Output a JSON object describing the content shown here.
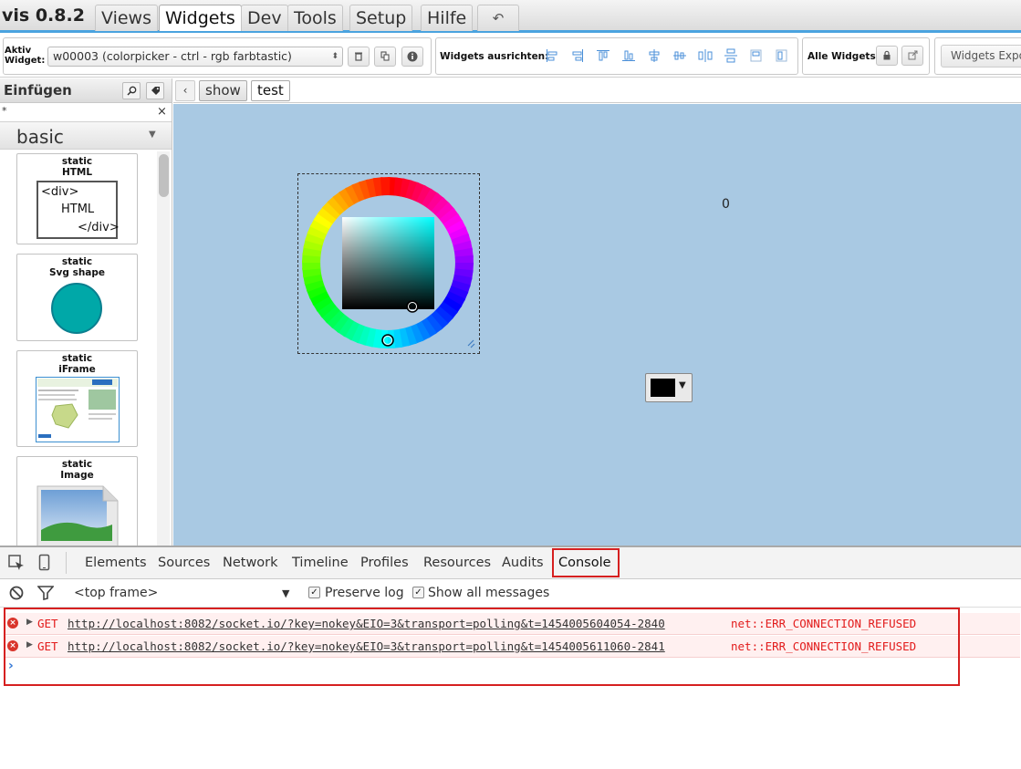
{
  "app": {
    "title": "vis 0.8.2",
    "tabs": [
      {
        "label": "Views"
      },
      {
        "label": "Widgets"
      },
      {
        "label": "Dev"
      },
      {
        "label": "Tools"
      },
      {
        "label": "Setup"
      },
      {
        "label": "Hilfe"
      }
    ],
    "undo_icon": "undo-icon",
    "active_tab": "Widgets"
  },
  "toolbar": {
    "aktiv_label_line1": "Aktiv",
    "aktiv_label_line2": "Widget:",
    "selected_widget": "w00003 (colorpicker - ctrl - rgb farbtastic)",
    "widget_buttons": [
      "trash-icon",
      "copy-icon",
      "info-icon"
    ],
    "align_label": "Widgets ausrichten:",
    "alle_label": "Alle Widgets:",
    "alle_buttons": [
      "lock-icon",
      "external-link-icon"
    ],
    "export_label": "Widgets Expo"
  },
  "left_panel": {
    "title": "Einfügen",
    "title_buttons": [
      "search-icon",
      "tag-icon"
    ],
    "filter_value": "*",
    "clear_label": "×",
    "category": "basic",
    "widgets": [
      {
        "cat": "static",
        "name": "HTML",
        "preview_lines": [
          "<div>",
          "HTML",
          "</div>"
        ]
      },
      {
        "cat": "static",
        "name": "Svg shape"
      },
      {
        "cat": "static",
        "name": "iFrame"
      },
      {
        "cat": "static",
        "name": "Image"
      }
    ]
  },
  "views": {
    "prev_label": "‹",
    "tabs": [
      "show",
      "test"
    ],
    "active": "test"
  },
  "canvas": {
    "counter_value": "0",
    "color_select_value": "#000000",
    "color_select_arrow": "▼",
    "accent_background": "#a9c9e3"
  },
  "devtools": {
    "tabs": [
      "Elements",
      "Sources",
      "Network",
      "Timeline",
      "Profiles",
      "Resources",
      "Audits",
      "Console"
    ],
    "active_tab": "Console",
    "frame_select": "<top frame>",
    "frame_arrow": "▼",
    "checkboxes": [
      {
        "label": "Preserve log",
        "checked": true
      },
      {
        "label": "Show all messages",
        "checked": true
      }
    ],
    "errors": [
      {
        "method": "GET",
        "url": "http://localhost:8082/socket.io/?key=nokey&EIO=3&transport=polling&t=1454005604054-2840",
        "status": "net::ERR_CONNECTION_REFUSED"
      },
      {
        "method": "GET",
        "url": "http://localhost:8082/socket.io/?key=nokey&EIO=3&transport=polling&t=1454005611060-2841",
        "status": "net::ERR_CONNECTION_REFUSED"
      }
    ],
    "prompt": "›",
    "error_color": "#e21b1b"
  }
}
